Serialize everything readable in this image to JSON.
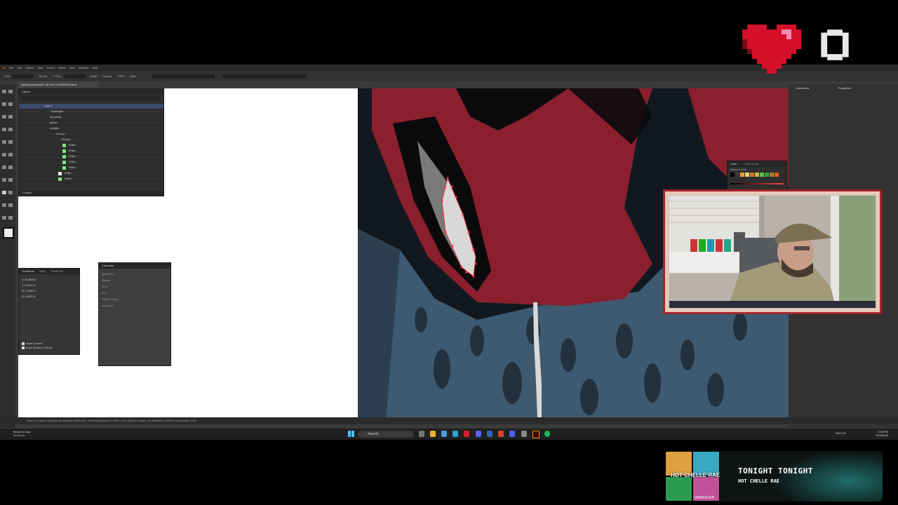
{
  "app": {
    "menu": [
      "File",
      "Edit",
      "Object",
      "Type",
      "Select",
      "Effect",
      "View",
      "Window",
      "Help"
    ],
    "control_bar": [
      "Path",
      "Stroke:",
      "0.75 pt",
      "Basic",
      "Opacity:",
      "100%",
      "Style:"
    ],
    "document_tab": "spidey boards.psd* @ 400 % (RGB/Preview)",
    "layers_title": "Layers",
    "layers": [
      {
        "label": "Layer 1"
      },
      {
        "label": "<Rectangle>"
      },
      {
        "label": "top spidey"
      },
      {
        "label": "gloves"
      },
      {
        "label": "pumpkin"
      },
      {
        "label": "<Group>"
      },
      {
        "label": "<Group>"
      },
      {
        "label": "<Path>"
      },
      {
        "label": "<Path>"
      },
      {
        "label": "<Path>"
      },
      {
        "label": "<Path>"
      },
      {
        "label": "<Path>"
      },
      {
        "label": "<Path>"
      },
      {
        "label": "<Path>"
      }
    ],
    "layers_footer": "2 Layers",
    "transform_tabs": [
      "Transform",
      "Align",
      "Pathfinder"
    ],
    "transform_fields": [
      "X: 16.4893 in",
      "Y: 6.4626 in",
      "W: 0.2882 in",
      "H: 0.8957 in"
    ],
    "transform_options": [
      "Scale Corners",
      "Scale Strokes & Effects"
    ],
    "character_title": "Character",
    "character_fields": [
      "Myriad Pro",
      "Regular",
      "12 pt",
      "Auto",
      "Snap to Glyph",
      "Advanced"
    ],
    "color_tabs": [
      "Color",
      "Color Guide"
    ],
    "color_recent": "Recent Colors",
    "swatch_colors": [
      "#000000",
      "#3a3a3a",
      "#f0a030",
      "#e8d070",
      "#c07a20",
      "#d0b050",
      "#60c050",
      "#3a9a3a",
      "#b08030",
      "#e06020"
    ],
    "status_text": "Select an object to apply the sampled attributes | Select Eyedropper | Select the object to sample its attributes | Shift to only sample color",
    "status_sub": "spidey Eyedropper Tool",
    "right_dock": {
      "comments": "Comments",
      "properties": "Properties"
    }
  },
  "taskbar": {
    "weather_line1": "Temps to drop",
    "weather_line2": "Tomorrow",
    "search_placeholder": "Search",
    "lang": "ENG US",
    "time": "2:06 PM",
    "date": "5/24/2026"
  },
  "now_playing": {
    "title": "TONIGHT TONIGHT",
    "artist": "HOT CHELLE RAE",
    "album_text": "HOT CHELLE RAE",
    "album_sub": "WHATEVER"
  },
  "colors": {
    "spider_red": "#8a1f2e",
    "suit_blue": "#3e5a70",
    "heart_red": "#d4102a",
    "frame_red": "#a3222b"
  }
}
